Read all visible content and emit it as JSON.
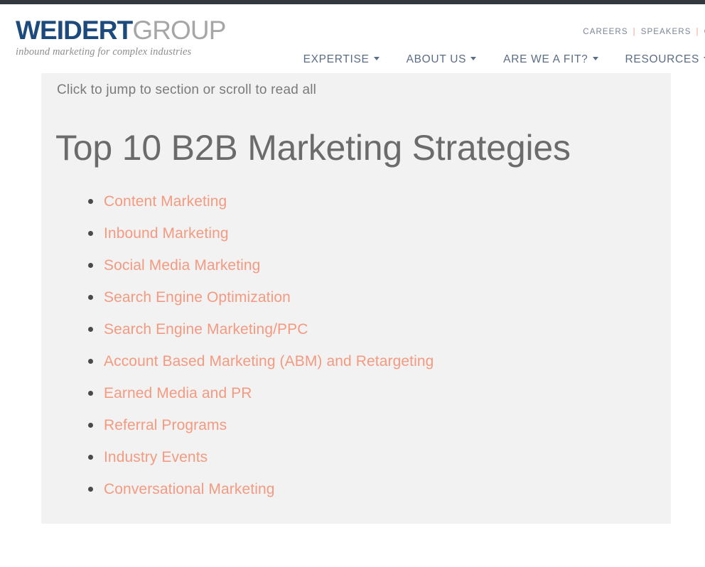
{
  "header": {
    "logo": {
      "word_primary": "WEIDERT",
      "word_secondary": "GROUP",
      "tagline": "inbound marketing for complex industries",
      "primary_color": "#1d4a7c",
      "secondary_color": "#a6a6a6"
    },
    "utility_nav": {
      "items": [
        "CAREERS",
        "SPEAKERS",
        "C"
      ],
      "separator": "|",
      "separator_color": "#f3a08a",
      "text_color": "#7b8696"
    },
    "main_nav": {
      "items": [
        {
          "label": "EXPERTISE",
          "has_dropdown": true
        },
        {
          "label": "ABOUT US",
          "has_dropdown": true
        },
        {
          "label": "ARE WE A FIT?",
          "has_dropdown": true
        },
        {
          "label": "RESOURCES",
          "has_dropdown": true
        }
      ],
      "text_color": "#5b6d85",
      "dropdown_icon": "chevron-down-icon"
    }
  },
  "content": {
    "jump_note": "Click to jump to section or scroll to read all",
    "title": "Top 10 B2B Marketing Strategies",
    "background_color": "#f2f2f2",
    "link_color": "#f49a80",
    "bullet_color": "#4a4a4a",
    "strategies": [
      {
        "label": "Content Marketing"
      },
      {
        "label": "Inbound Marketing"
      },
      {
        "label": "Social Media Marketing"
      },
      {
        "label": "Search Engine Optimization"
      },
      {
        "label": "Search Engine Marketing/PPC"
      },
      {
        "label": "Account Based Marketing (ABM) and Retargeting"
      },
      {
        "label": "Earned Media and PR"
      },
      {
        "label": "Referral Programs"
      },
      {
        "label": "Industry Events"
      },
      {
        "label": "Conversational Marketing"
      }
    ]
  }
}
